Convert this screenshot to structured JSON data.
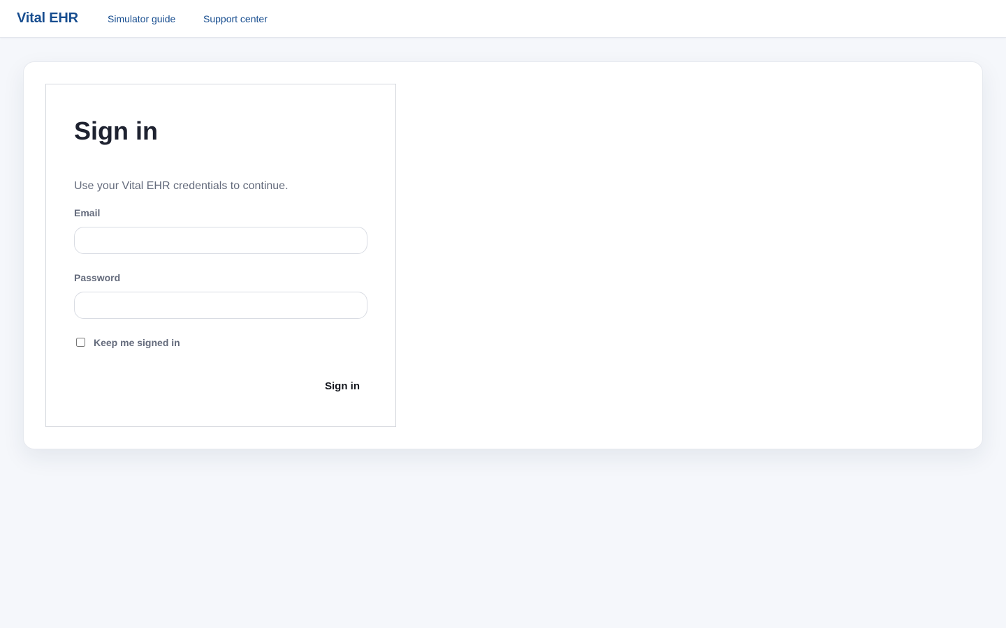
{
  "header": {
    "brand": "Vital EHR",
    "nav": {
      "simulator_guide": "Simulator guide",
      "support_center": "Support center"
    }
  },
  "signin": {
    "title": "Sign in",
    "subtitle": "Use your Vital EHR credentials to continue.",
    "email": {
      "label": "Email",
      "value": "",
      "placeholder": ""
    },
    "password": {
      "label": "Password",
      "value": "",
      "placeholder": ""
    },
    "remember": {
      "label": "Keep me signed in",
      "checked": false
    },
    "submit_label": "Sign in"
  },
  "colors": {
    "brand": "#174d8f",
    "page_background": "#f5f7fb",
    "muted_text": "#646b7c"
  }
}
